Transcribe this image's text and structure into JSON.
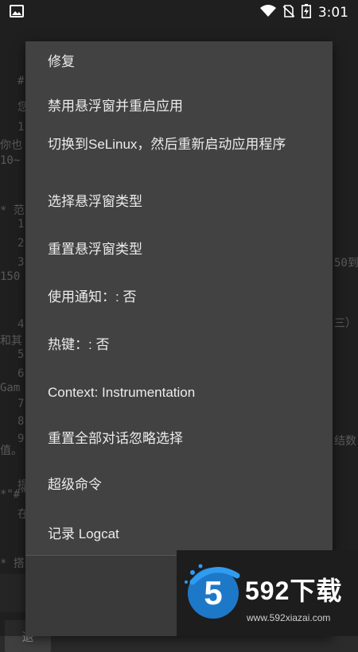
{
  "status_bar": {
    "time": "3:01",
    "icons": [
      "image-icon",
      "wifi-icon",
      "no-sim-icon",
      "battery-charging-icon"
    ]
  },
  "background": {
    "lines": [
      "#",
      "您",
      "1",
      "你也",
      "10~",
      "* 范",
      "1",
      "2",
      "3",
      "150",
      "4",
      "和其",
      "5",
      "6",
      "Gam",
      "7",
      "8",
      "9",
      "值。",
      "提",
      "*\"#\"",
      "在",
      "* 搭"
    ],
    "right_lines": [
      "50到",
      "三）",
      "结数"
    ],
    "bottom_button": "退"
  },
  "menu": {
    "items": [
      {
        "label": "修复"
      },
      {
        "label": "禁用悬浮窗并重启应用"
      },
      {
        "label": "切换到SeLinux，然后重新启动应用程序"
      },
      {
        "label": "选择悬浮窗类型"
      },
      {
        "label": "重置悬浮窗类型"
      },
      {
        "label": "使用通知：: 否"
      },
      {
        "label": "热键：: 否"
      },
      {
        "label": "Context: Instrumentation"
      },
      {
        "label": "重置全部对话忽略选择"
      },
      {
        "label": "超级命令"
      },
      {
        "label": "记录 Logcat"
      }
    ]
  },
  "watermark": {
    "logo_digit": "5",
    "brand": "592下载",
    "url": "www.592xiazai.com",
    "colors": {
      "accent": "#1e78c8",
      "accent_light": "#2f9cf0"
    }
  }
}
